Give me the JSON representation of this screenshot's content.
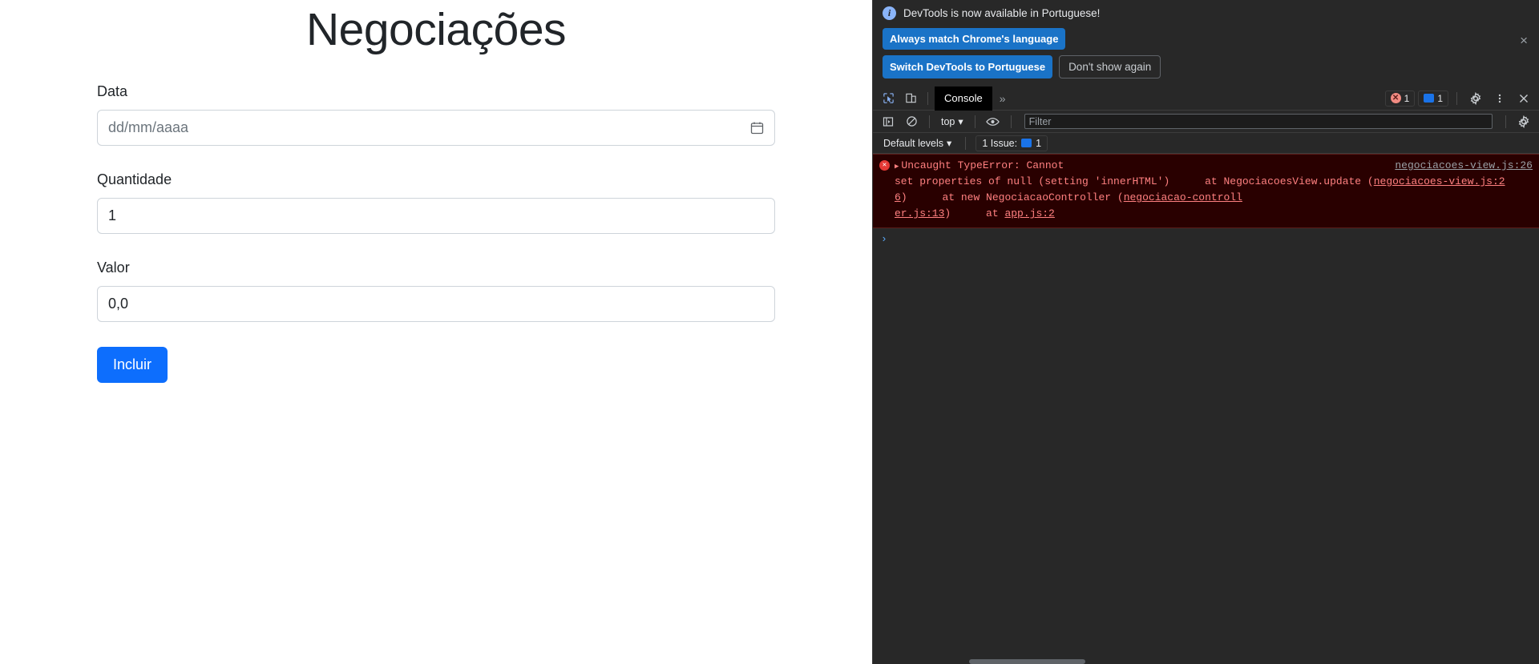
{
  "page": {
    "title": "Negociações",
    "fields": [
      {
        "label": "Data",
        "value": "dd/mm/aaaa",
        "is_placeholder": true,
        "icon": "calendar-icon"
      },
      {
        "label": "Quantidade",
        "value": "1",
        "is_placeholder": false
      },
      {
        "label": "Valor",
        "value": "0,0",
        "is_placeholder": false
      }
    ],
    "submit_label": "Incluir",
    "accent_color": "#0d6efd"
  },
  "devtools": {
    "banner": {
      "message": "DevTools is now available in Portuguese!",
      "primary_button": "Always match Chrome's language",
      "secondary_button": "Switch DevTools to Portuguese",
      "dismiss_button": "Don't show again",
      "close_icon": "×",
      "info_icon": "i"
    },
    "toolbar": {
      "inspect_icon": "inspect-cursor-icon",
      "device_icon": "device-toolbar-icon",
      "active_tab": "Console",
      "overflow": "»",
      "error_count": "1",
      "message_count": "1",
      "settings_icon": "gear-icon",
      "more_icon": "kebab-menu-icon",
      "close_icon": "×"
    },
    "filterbar": {
      "sidebar_icon": "console-sidebar-icon",
      "clear_icon": "clear-console-icon",
      "context": "top",
      "eye_icon": "live-expression-icon",
      "filter_placeholder": "Filter",
      "settings_icon": "gear-icon"
    },
    "levelbar": {
      "levels": "Default levels",
      "issues_label": "1 Issue:",
      "issues_count": "1"
    },
    "console": {
      "error_icon": "error-icon",
      "expand_icon": "▶",
      "line1": "Uncaught TypeError: Cannot",
      "line1_link": "negociacoes-view.js:26",
      "line2": "set properties of null (setting 'innerHTML')",
      "stack": [
        {
          "text": "at NegociacoesView.update (",
          "link": "negociacoes-view.js:2",
          "tail_link": "6",
          "tail": ")"
        },
        {
          "text": "at new NegociacaoController (",
          "link": "negociacao-controll",
          "tail_link": "er.js:13",
          "tail": ")"
        },
        {
          "text": "at ",
          "link": "app.js:2",
          "tail_link": "",
          "tail": ""
        }
      ],
      "prompt": "›"
    }
  }
}
